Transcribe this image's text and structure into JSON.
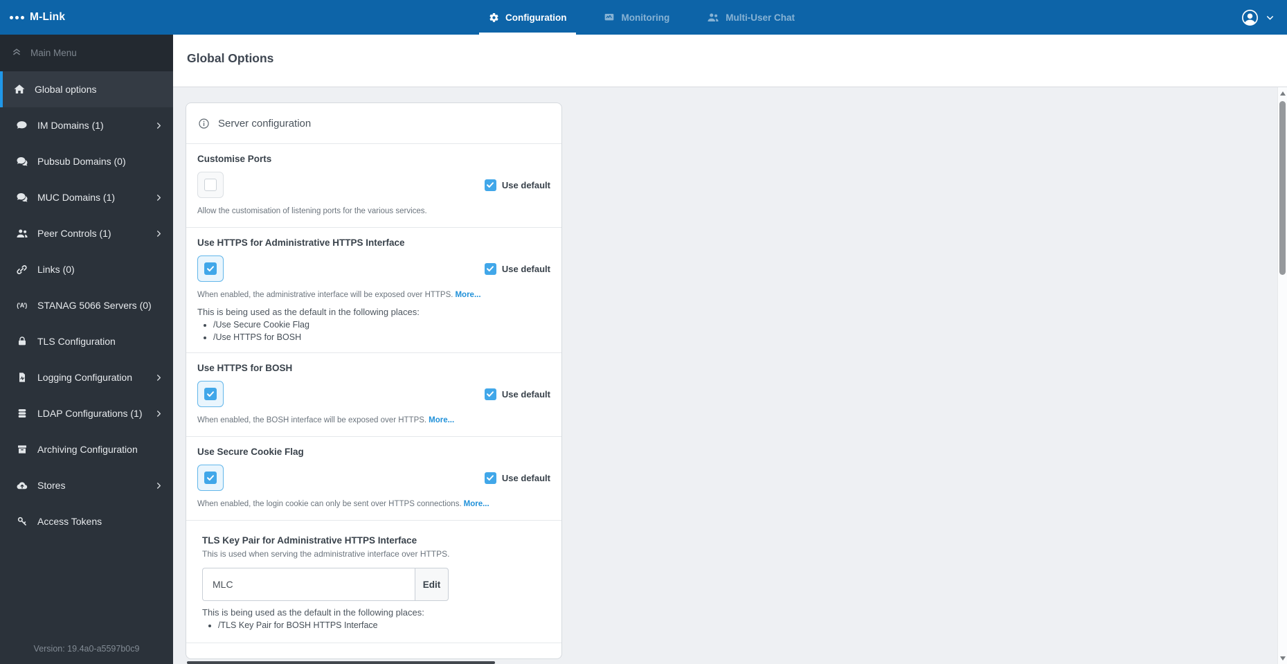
{
  "colors": {
    "topbar_blue": "#0d64a8",
    "sidebar_bg": "#2b323a",
    "active_item_accent": "#2097e8",
    "checkbox_blue": "#41a7e9",
    "link_blue": "#2191d9",
    "content_bg": "#eef0f3"
  },
  "topbar": {
    "brand": "M-Link",
    "brand_icon": "dots-icon",
    "tabs": [
      {
        "label": "Configuration",
        "icon": "gear-icon",
        "active": true
      },
      {
        "label": "Monitoring",
        "icon": "monitor-icon",
        "active": false
      },
      {
        "label": "Multi-User Chat",
        "icon": "people-icon",
        "active": false
      }
    ],
    "user": {
      "avatar_icon": "person-circle-icon",
      "chevron_icon": "chevron-down-icon"
    }
  },
  "sidebar": {
    "menu_header": {
      "label": "Main Menu",
      "icon": "angles-up-icon"
    },
    "items": [
      {
        "label": "Global options",
        "icon": "home-icon",
        "active": true,
        "expandable": false
      },
      {
        "label": "IM Domains (1)",
        "icon": "comment-icon",
        "active": false,
        "expandable": true
      },
      {
        "label": "Pubsub Domains (0)",
        "icon": "comments-icon",
        "active": false,
        "expandable": false
      },
      {
        "label": "MUC Domains (1)",
        "icon": "comments-icon",
        "active": false,
        "expandable": true
      },
      {
        "label": "Peer Controls (1)",
        "icon": "people-icon",
        "active": false,
        "expandable": true
      },
      {
        "label": "Links (0)",
        "icon": "link-icon",
        "active": false,
        "expandable": false
      },
      {
        "label": "STANAG 5066 Servers (0)",
        "icon": "stanag-icon",
        "active": false,
        "expandable": false
      },
      {
        "label": "TLS Configuration",
        "icon": "lock-icon",
        "active": false,
        "expandable": false
      },
      {
        "label": "Logging Configuration",
        "icon": "log-file-icon",
        "active": false,
        "expandable": true
      },
      {
        "label": "LDAP Configurations (1)",
        "icon": "database-icon",
        "active": false,
        "expandable": true
      },
      {
        "label": "Archiving Configuration",
        "icon": "archive-icon",
        "active": false,
        "expandable": false
      },
      {
        "label": "Stores",
        "icon": "cloud-upload-icon",
        "active": false,
        "expandable": true
      },
      {
        "label": "Access Tokens",
        "icon": "key-icon",
        "active": false,
        "expandable": false
      }
    ],
    "version": "Version: 19.4a0-a5597b0c9"
  },
  "page": {
    "title": "Global Options"
  },
  "card": {
    "header": {
      "label": "Server configuration",
      "icon": "info-circle-icon"
    },
    "use_default_label": "Use default",
    "sections": [
      {
        "type": "toggle",
        "title": "Customise Ports",
        "checked": false,
        "use_default_checked": true,
        "description": "Allow the customisation of listening ports for the various services.",
        "more_link": null,
        "used_in_label": null,
        "used_in": null
      },
      {
        "type": "toggle",
        "title": "Use HTTPS for Administrative HTTPS Interface",
        "checked": true,
        "use_default_checked": true,
        "description": "When enabled, the administrative interface will be exposed over HTTPS.",
        "more_link": "More...",
        "used_in_label": "This is being used as the default in the following places:",
        "used_in": [
          "/Use Secure Cookie Flag",
          "/Use HTTPS for BOSH"
        ]
      },
      {
        "type": "toggle",
        "title": "Use HTTPS for BOSH",
        "checked": true,
        "use_default_checked": true,
        "description": "When enabled, the BOSH interface will be exposed over HTTPS.",
        "more_link": "More...",
        "used_in_label": null,
        "used_in": null
      },
      {
        "type": "toggle",
        "title": "Use Secure Cookie Flag",
        "checked": true,
        "use_default_checked": true,
        "description": "When enabled, the login cookie can only be sent over HTTPS connections.",
        "more_link": "More...",
        "used_in_label": null,
        "used_in": null
      },
      {
        "type": "keypair",
        "title": "TLS Key Pair for Administrative HTTPS Interface",
        "subtitle": "This is used when serving the administrative interface over HTTPS.",
        "value": "MLC",
        "button_label": "Edit",
        "used_in_label": "This is being used as the default in the following places:",
        "used_in": [
          "/TLS Key Pair for BOSH HTTPS Interface"
        ]
      }
    ]
  }
}
